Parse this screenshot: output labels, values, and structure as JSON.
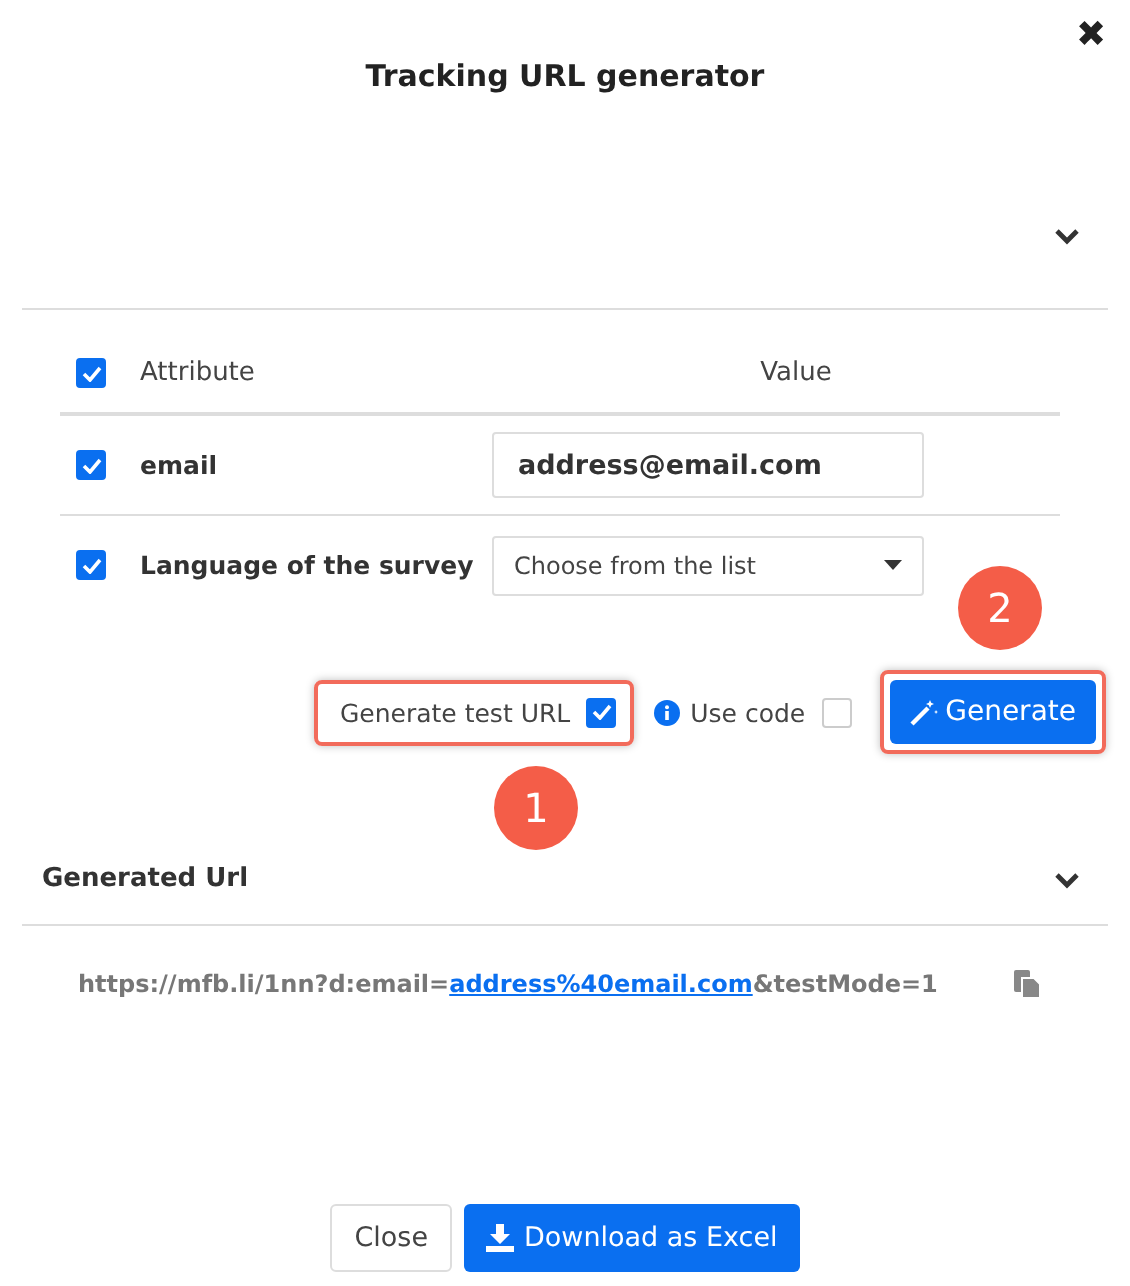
{
  "dialog": {
    "title": "Tracking URL generator",
    "close": "✖"
  },
  "top_section": {
    "expanded": false
  },
  "table": {
    "all_checked": true,
    "columns": [
      "Attribute",
      "Value"
    ],
    "rows": [
      {
        "kind": "input",
        "checked": true,
        "attribute": "email",
        "value": "address@email.com"
      },
      {
        "kind": "select",
        "checked": true,
        "attribute": "Language of the survey",
        "placeholder": "Choose from the list"
      }
    ]
  },
  "options": {
    "test_url": {
      "label": "Generate test URL",
      "checked": true,
      "highlighted": true,
      "callout": "1"
    },
    "use_code": {
      "label": "Use code",
      "checked": false
    },
    "generate": {
      "label": "Generate",
      "highlighted": true,
      "callout": "2"
    }
  },
  "generated": {
    "title": "Generated Url",
    "expanded": true,
    "url_prefix": "https://mfb.li/1nn?d:email=",
    "url_link": "address%40email.com",
    "url_suffix": "&testMode=1"
  },
  "footer": {
    "buttons": [
      {
        "kind": "secondary",
        "label": "Close"
      },
      {
        "kind": "primary",
        "label": "Download as Excel"
      }
    ]
  }
}
